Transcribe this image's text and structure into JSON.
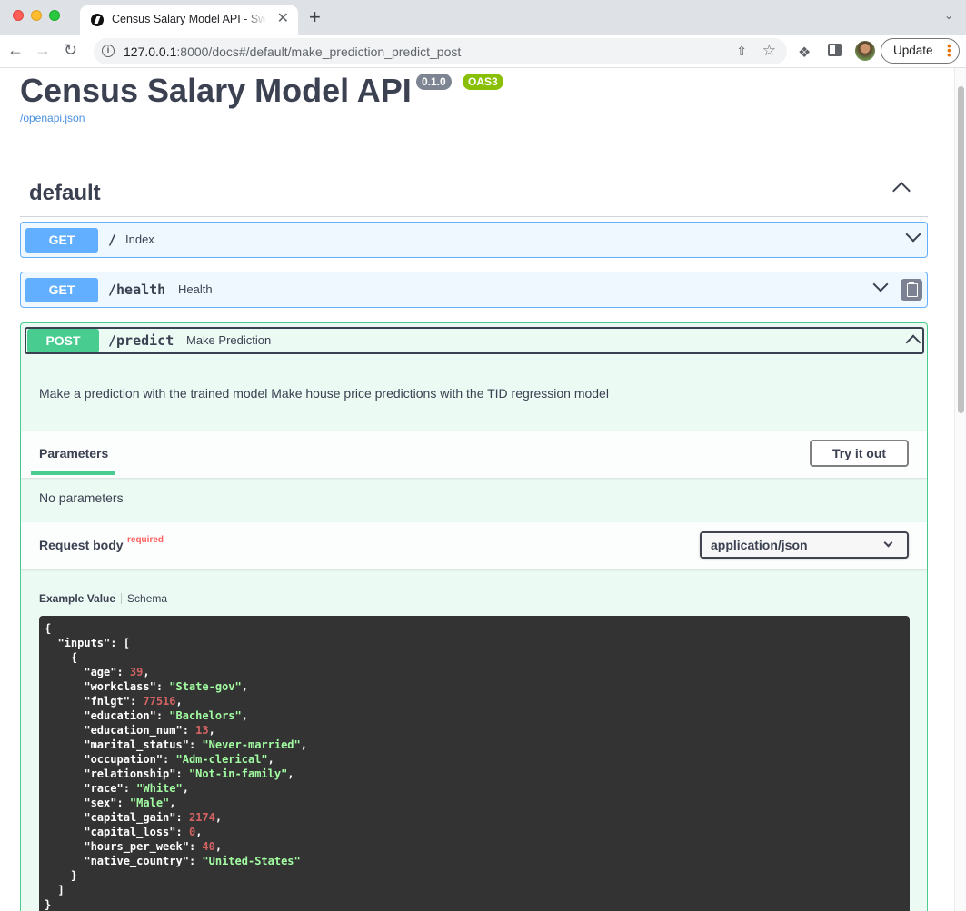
{
  "browser": {
    "tab_title": "Census Salary Model API - Swagger UI",
    "tab_close": "✕",
    "new_tab": "+",
    "url_host": "127.0.0.1",
    "url_path": ":8000/docs#/default/make_prediction_predict_post",
    "update_label": "Update"
  },
  "api": {
    "title": "Census Salary Model API",
    "version": "0.1.0",
    "oas": "OAS3",
    "openapi_link": "/openapi.json"
  },
  "section": {
    "title": "default"
  },
  "operations": [
    {
      "method": "GET",
      "path": "/",
      "summary": "Index"
    },
    {
      "method": "GET",
      "path": "/health",
      "summary": "Health"
    },
    {
      "method": "POST",
      "path": "/predict",
      "summary": "Make Prediction"
    }
  ],
  "predict": {
    "description": "Make a prediction with the trained model Make house price predictions with the TID regression model",
    "parameters_tab": "Parameters",
    "try_it_out": "Try it out",
    "no_parameters": "No parameters",
    "request_body_label": "Request body",
    "required_label": "required",
    "content_type": "application/json",
    "example_tab": "Example Value",
    "schema_tab": "Schema",
    "example": {
      "inputs": [
        {
          "age": 39,
          "workclass": "State-gov",
          "fnlgt": 77516,
          "education": "Bachelors",
          "education_num": 13,
          "marital_status": "Never-married",
          "occupation": "Adm-clerical",
          "relationship": "Not-in-family",
          "race": "White",
          "sex": "Male",
          "capital_gain": 2174,
          "capital_loss": 0,
          "hours_per_week": 40,
          "native_country": "United-States"
        }
      ]
    }
  },
  "colors": {
    "get": "#61affe",
    "post": "#49cc90",
    "code_bg": "#333333",
    "code_string": "#a2fca2",
    "code_number": "#d36363"
  }
}
